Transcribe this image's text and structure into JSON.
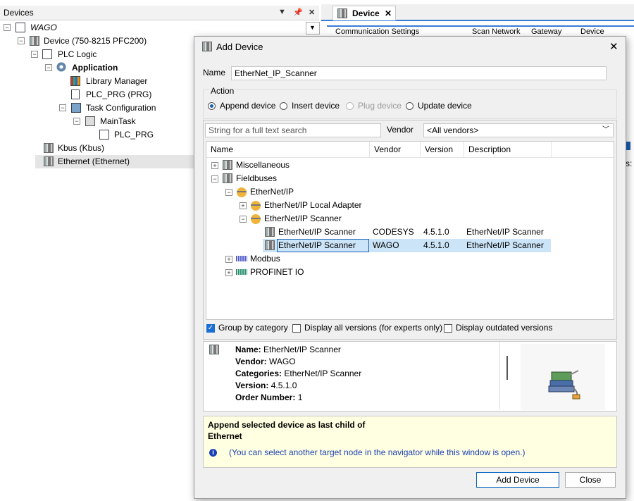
{
  "devices_pane": {
    "title": "Devices",
    "header_icons": [
      "chevron-down",
      "pin",
      "close"
    ],
    "tree": [
      {
        "label": "WAGO",
        "style": "italic"
      },
      {
        "label": "Device (750-8215 PFC200)"
      },
      {
        "label": "PLC Logic"
      },
      {
        "label": "Application",
        "style": "bold"
      },
      {
        "label": "Library Manager"
      },
      {
        "label": "PLC_PRG (PRG)"
      },
      {
        "label": "Task Configuration"
      },
      {
        "label": "MainTask"
      },
      {
        "label": "PLC_PRG"
      },
      {
        "label": "Kbus (Kbus)"
      },
      {
        "label": "Ethernet (Ethernet)",
        "selected": true
      }
    ]
  },
  "editor": {
    "tab_label": "Device",
    "toolbar": [
      "Communication Settings",
      "Scan Network",
      "Gateway",
      "Device"
    ],
    "side_text": "s:"
  },
  "dialog": {
    "title": "Add Device",
    "name_label": "Name",
    "name_value": "EtherNet_IP_Scanner",
    "action_label": "Action",
    "actions": [
      {
        "label": "Append device",
        "selected": true
      },
      {
        "label": "Insert device",
        "selected": false
      },
      {
        "label": "Plug device",
        "disabled": true
      },
      {
        "label": "Update device",
        "selected": false
      }
    ],
    "search_placeholder": "String for a full text search",
    "vendor_label": "Vendor",
    "vendor_value": "<All vendors>",
    "columns": [
      "Name",
      "Vendor",
      "Version",
      "Description"
    ],
    "catalog": [
      {
        "label": "Miscellaneous",
        "expander": "+"
      },
      {
        "label": "Fieldbuses",
        "expander": "-"
      },
      {
        "label": "EtherNet/IP",
        "expander": "-"
      },
      {
        "label": "EtherNet/IP Local Adapter",
        "expander": "+"
      },
      {
        "label": "EtherNet/IP Scanner",
        "expander": "-"
      },
      {
        "label": "EtherNet/IP Scanner",
        "vendor": "CODESYS",
        "version": "4.5.1.0",
        "description": "EtherNet/IP Scanner"
      },
      {
        "label": "EtherNet/IP Scanner",
        "vendor": "WAGO",
        "version": "4.5.1.0",
        "description": "EtherNet/IP Scanner",
        "selected": true
      },
      {
        "label": "Modbus",
        "expander": "+"
      },
      {
        "label": "PROFINET IO",
        "expander": "+"
      }
    ],
    "options": [
      {
        "label": "Group by category",
        "checked": true
      },
      {
        "label": "Display all versions (for experts only)",
        "checked": false
      },
      {
        "label": "Display outdated versions",
        "checked": false
      }
    ],
    "info": {
      "name_key": "Name:",
      "name_val": "EtherNet/IP Scanner",
      "vendor_key": "Vendor:",
      "vendor_val": "WAGO",
      "categories_key": "Categories:",
      "categories_val": "EtherNet/IP Scanner",
      "version_key": "Version:",
      "version_val": "4.5.1.0",
      "order_key": "Order Number:",
      "order_val": "1"
    },
    "hint_line1": "Append selected device as last child of",
    "hint_line2": "Ethernet",
    "hint_note": "(You can select another target node in the navigator while this window is open.)",
    "add_button": "Add Device",
    "close_button": "Close",
    "accent_color": "#0a66c2",
    "selection_color": "#cce4f7",
    "hint_bg_color": "#ffffe1"
  }
}
